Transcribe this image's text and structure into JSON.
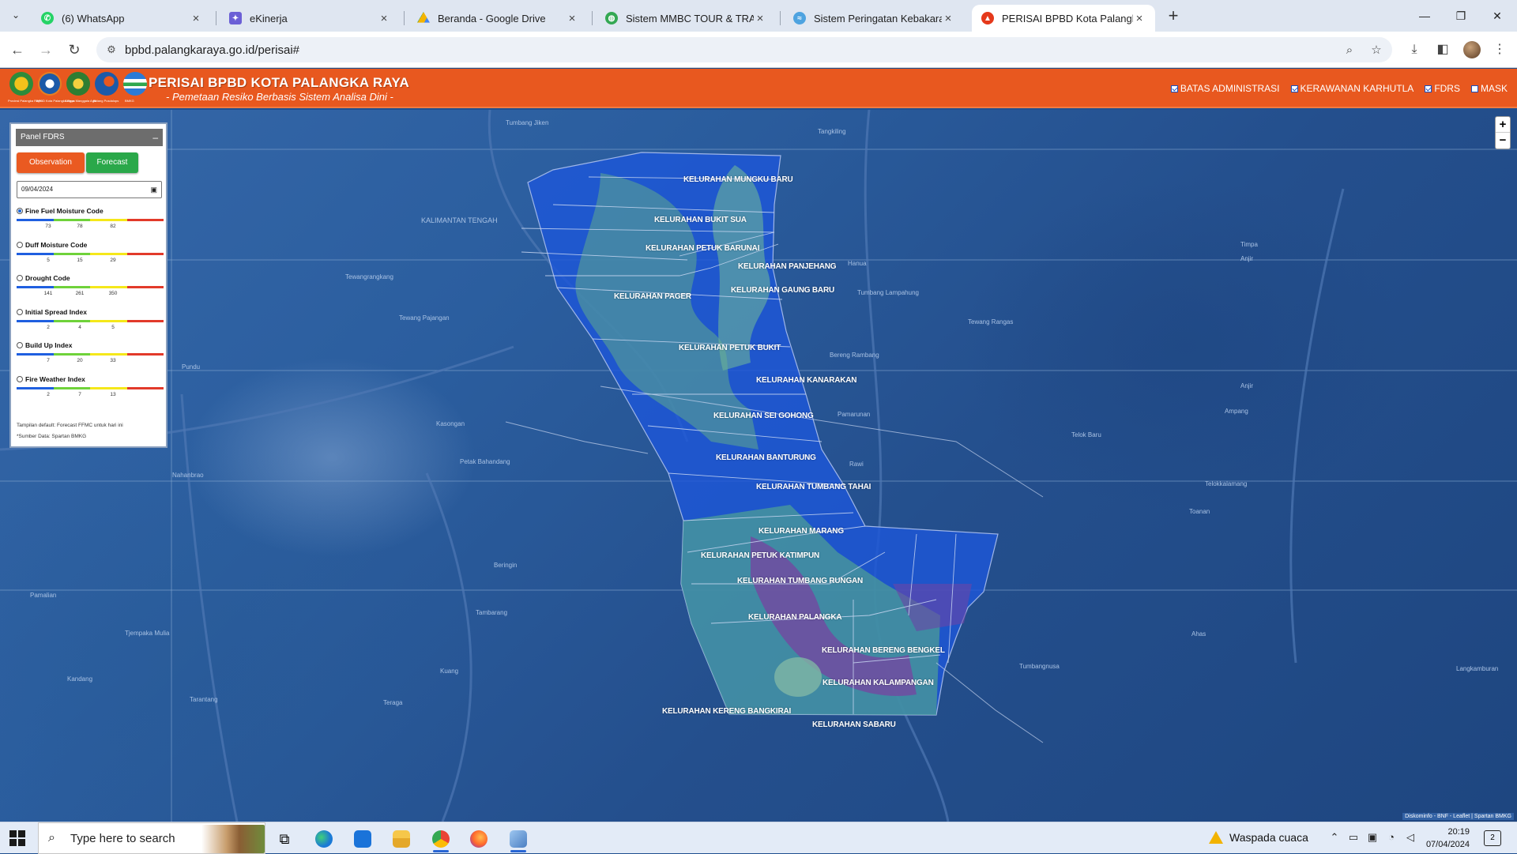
{
  "browser": {
    "tabs": [
      {
        "label": "(6) WhatsApp",
        "icon": "whatsapp-icon",
        "color": "#25d366"
      },
      {
        "label": "eKinerja",
        "icon": "ekinerja-icon",
        "color": "#6b5fd6"
      },
      {
        "label": "Beranda - Google Drive",
        "icon": "google-drive-icon",
        "color": "#f4b400"
      },
      {
        "label": "Sistem MMBC TOUR & TRAVEL",
        "icon": "globe-icon",
        "color": "#34a853"
      },
      {
        "label": "Sistem Peringatan Kebakaran H",
        "icon": "fire-warning-icon",
        "color": "#4ea3e0"
      },
      {
        "label": "PERISAI BPBD Kota Palangka Ra",
        "icon": "bpbd-icon",
        "color": "#e5391b"
      }
    ],
    "url": "bpbd.palangkaraya.go.id/perisai#"
  },
  "header": {
    "title": "PERISAI BPBD KOTA PALANGKA RAYA",
    "subtitle": "- Pemetaan Resiko Berbasis Sistem Analisa Dini -",
    "logo_captions": [
      "Provinsi Palangka Raya",
      "BPBD Kota Palangka Raya",
      "Satgas Manggala Agni",
      "Bidang Pusdalops",
      "BMKG"
    ],
    "layers": [
      {
        "label": "BATAS ADMINISTRASI",
        "checked": true
      },
      {
        "label": "KERAWANAN KARHUTLA",
        "checked": true
      },
      {
        "label": "FDRS",
        "checked": true
      },
      {
        "label": "MASK",
        "checked": false
      }
    ]
  },
  "panel": {
    "title": "Panel FDRS",
    "observation_label": "Observation",
    "forecast_label": "Forecast",
    "date_value": "09/04/2024",
    "indices": [
      {
        "label": "Fine Fuel Moisture Code",
        "selected": true,
        "ticks": [
          "73",
          "78",
          "82"
        ]
      },
      {
        "label": "Duff Moisture Code",
        "selected": false,
        "ticks": [
          "5",
          "15",
          "29"
        ]
      },
      {
        "label": "Drought Code",
        "selected": false,
        "ticks": [
          "141",
          "261",
          "350"
        ]
      },
      {
        "label": "Initial Spread Index",
        "selected": false,
        "ticks": [
          "2",
          "4",
          "5"
        ]
      },
      {
        "label": "Build Up Index",
        "selected": false,
        "ticks": [
          "7",
          "20",
          "33"
        ]
      },
      {
        "label": "Fire Weather Index",
        "selected": false,
        "ticks": [
          "2",
          "7",
          "13"
        ]
      }
    ],
    "scale_colors": [
      "#1f5fe0",
      "#6fd23a",
      "#f5e81a",
      "#e23a2a"
    ],
    "note": "Tampilan default: Forecast FFMC untuk hari ini",
    "source": "*Sumber Data: Spartan BMKG"
  },
  "map": {
    "kelurahan": [
      "KELURAHAN MUNGKU BARU",
      "KELURAHAN BUKIT SUA",
      "KELURAHAN PETUK BARUNAI",
      "KELURAHAN PANJEHANG",
      "KELURAHAN GAUNG BARU",
      "KELURAHAN PAGER",
      "KELURAHAN PETUK BUKIT",
      "KELURAHAN KANARAKAN",
      "KELURAHAN SEI GOHONG",
      "KELURAHAN BANTURUNG",
      "KELURAHAN TUMBANG TAHAI",
      "KELURAHAN MARANG",
      "KELURAHAN PETUK KATIMPUN",
      "KELURAHAN TUMBANG RUNGAN",
      "KELURAHAN PALANGKA",
      "KELURAHAN BERENG BENGKEL",
      "KELURAHAN KALAMPANGAN",
      "KELURAHAN KERENG BANGKIRAI",
      "KELURAHAN SABARU"
    ],
    "places": [
      "Tumbang Jiken",
      "Tangkiling",
      "KALIMANTAN TENGAH",
      "Tewangrangkang",
      "Hanua",
      "Timpa",
      "Tumbang Lampahung",
      "Anjir",
      "Bereng Rambang",
      "Tewang Pajangan",
      "Pundu",
      "Kasongan",
      "Pamarunan",
      "Ampang",
      "Tewang Rangas",
      "Telok Baru",
      "Telokkalamang",
      "Nahanbrao",
      "Petak Bahandang",
      "Rawi",
      "Toanan",
      "Beringin",
      "Pamalian",
      "Tambarang",
      "Tjempaka Mulia",
      "Ahas",
      "Tumbangnusa",
      "Kandang",
      "Kuang",
      "Tarantang",
      "Teraga",
      "Langkamburan"
    ],
    "attribution": "Diskominfo - BNF - Leaflet | Spartan BMKG"
  },
  "taskbar": {
    "search_placeholder": "Type here to search",
    "weather": "Waspada cuaca",
    "time": "20:19",
    "date": "07/04/2024",
    "notifications": "2"
  }
}
